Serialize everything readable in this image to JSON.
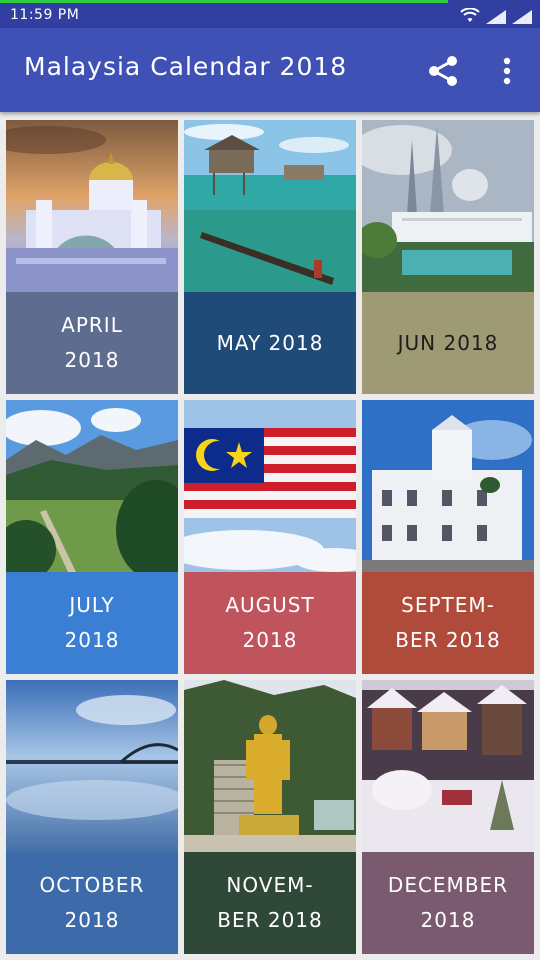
{
  "status_bar": {
    "time": "11:59 PM"
  },
  "app_bar": {
    "title": "Malaysia Calendar 2018"
  },
  "months": [
    {
      "line1": "APRIL",
      "line2": "2018",
      "color": "#5e6d8f",
      "scene": "mosque-sunset"
    },
    {
      "line1": "MAY 2018",
      "line2": "",
      "color": "#204a78",
      "scene": "stilt-houses-sea"
    },
    {
      "line1": "JUN 2018",
      "line2": "",
      "color": "#9d9a74",
      "scene": "twin-towers-mosque"
    },
    {
      "line1": "JULY",
      "line2": "2018",
      "color": "#3a7fd4",
      "scene": "mountain-valley"
    },
    {
      "line1": "AUGUST",
      "line2": "2018",
      "color": "#c0545d",
      "scene": "malaysia-flag"
    },
    {
      "line1": "SEPTEM-",
      "line2": "BER 2018",
      "color": "#b04a3a",
      "scene": "white-colonial-building"
    },
    {
      "line1": "OCTOBER",
      "line2": "2018",
      "color": "#3d6ba9",
      "scene": "bridge-lake"
    },
    {
      "line1": "NOVEM-",
      "line2": "BER 2018",
      "color": "#2f4838",
      "scene": "golden-statue-cave"
    },
    {
      "line1": "DECEMBER",
      "line2": "2018",
      "color": "#7a5a6e",
      "scene": "snow-village"
    }
  ]
}
